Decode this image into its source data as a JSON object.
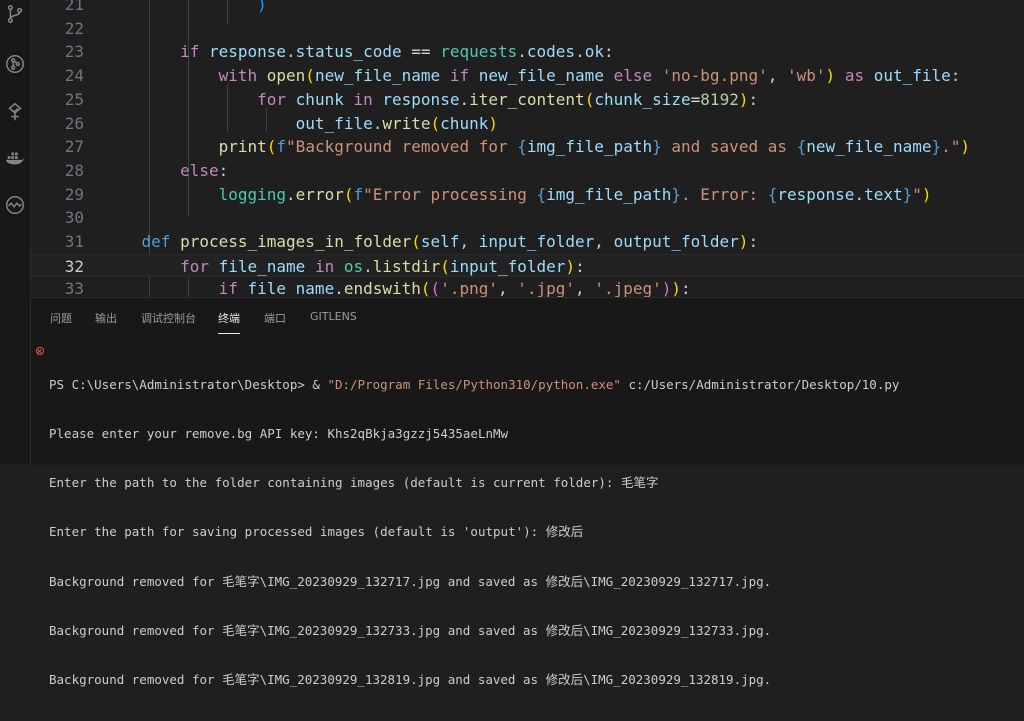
{
  "activity_bar": {
    "icons": [
      "source-control-icon",
      "git-graph-icon",
      "testing-icon",
      "docker-icon",
      "remote-icon"
    ]
  },
  "editor": {
    "current_line": "32",
    "line_numbers": [
      "21",
      "22",
      "23",
      "24",
      "25",
      "26",
      "27",
      "28",
      "29",
      "30",
      "31",
      "32",
      "33"
    ]
  },
  "panel": {
    "tabs": [
      "问题",
      "输出",
      "调试控制台",
      "终端",
      "端口",
      "GITLENS"
    ],
    "active_tab": "终端",
    "terminal": {
      "prompt": "PS C:\\Users\\Administrator\\Desktop> & ",
      "exe_path": "\"D:/Program Files/Python310/python.exe\"",
      "script_path": " c:/Users/Administrator/Desktop/10.py",
      "lines": [
        "Please enter your remove.bg API key: Khs2qBkja3gzzj5435aeLnMw",
        "Enter the path to the folder containing images (default is current folder): 毛笔字",
        "Enter the path for saving processed images (default is 'output'): 修改后",
        "Background removed for 毛笔字\\IMG_20230929_132717.jpg and saved as 修改后\\IMG_20230929_132717.jpg.",
        "Background removed for 毛笔字\\IMG_20230929_132733.jpg and saved as 修改后\\IMG_20230929_132733.jpg.",
        "Background removed for 毛笔字\\IMG_20230929_132819.jpg and saved as 修改后\\IMG_20230929_132819.jpg."
      ]
    }
  }
}
